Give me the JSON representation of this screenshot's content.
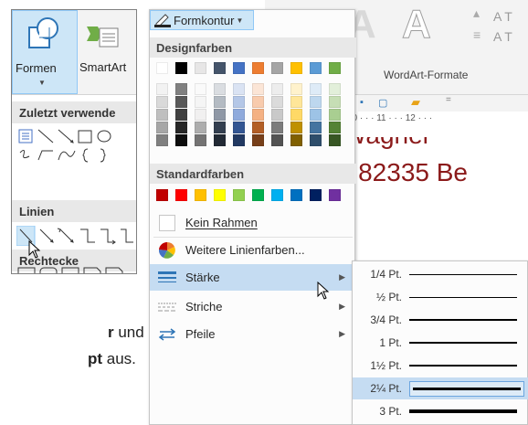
{
  "shapes_panel": {
    "formen_label": "Formen",
    "smartart_label": "SmartArt",
    "recent_header": "Zuletzt verwende",
    "lines_header": "Linien",
    "rect_header": "Rechtecke"
  },
  "instruction": {
    "line1_bold": "r",
    "line1_rest": " und",
    "line2_bold": "pt",
    "line2_rest": " aus."
  },
  "document": {
    "wordart_group_label": "WordArt-Formate",
    "ruler_text": "10 · · · 11 · · · 12 · · ·",
    "line1": "Wagner",
    "line2": "- 82335 Be"
  },
  "formkontur": {
    "button_label": "Formkontur",
    "design_colors_header": "Designfarben",
    "standard_colors_header": "Standardfarben",
    "no_border": "Kein Rahmen",
    "more_colors": "Weitere Linienfarben...",
    "weight": "Stärke",
    "dashes": "Striche",
    "arrows": "Pfeile",
    "theme_top_row": [
      "#ffffff",
      "#000000",
      "#e7e6e6",
      "#44546a",
      "#4472c4",
      "#ed7d31",
      "#a5a5a5",
      "#ffc000",
      "#5b9bd5",
      "#70ad47"
    ],
    "standard_colors": [
      "#c00000",
      "#ff0000",
      "#ffc000",
      "#ffff00",
      "#92d050",
      "#00b050",
      "#00b0f0",
      "#0070c0",
      "#002060",
      "#7030a0"
    ]
  },
  "weights": {
    "selected": "2¼ Pt.",
    "items": [
      "1/4 Pt.",
      "½ Pt.",
      "3/4 Pt.",
      "1 Pt.",
      "1½ Pt.",
      "2¼ Pt.",
      "3 Pt."
    ]
  }
}
